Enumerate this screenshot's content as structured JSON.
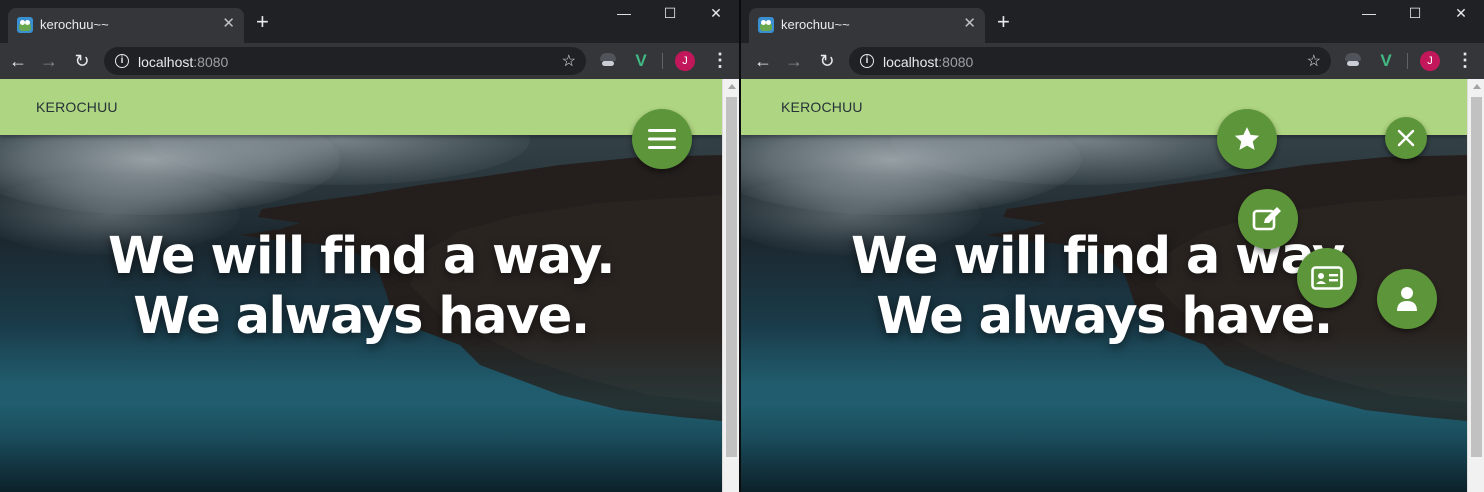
{
  "left": {
    "tab": {
      "title": "kerochuu~~",
      "close": "✕"
    },
    "new_tab": "+",
    "window_controls": {
      "minimize": "—",
      "maximize": "☐",
      "close": "✕"
    },
    "address": {
      "host": "localhost",
      "port": ":8080"
    },
    "profile_initial": "J",
    "app": {
      "brand": "KEROCHUU",
      "hero_line1": "We will find a way.",
      "hero_line2": "We always have.",
      "fab": {
        "state": "closed",
        "icon": "menu-icon"
      }
    }
  },
  "right": {
    "tab": {
      "title": "kerochuu~~",
      "close": "✕"
    },
    "new_tab": "+",
    "window_controls": {
      "minimize": "—",
      "maximize": "☐",
      "close": "✕"
    },
    "address": {
      "host": "localhost",
      "port": ":8080"
    },
    "profile_initial": "J",
    "app": {
      "brand": "KEROCHUU",
      "hero_line1": "We will find a way.",
      "hero_line2": "We always have.",
      "fab": {
        "state": "open",
        "icon": "close-icon",
        "actions": [
          "star-icon",
          "edit-icon",
          "contact-card-icon",
          "user-icon"
        ]
      }
    }
  },
  "colors": {
    "appbar": "#aed581",
    "fab": "#5d963a",
    "browser_chrome": "#202124",
    "toolbar": "#35363a"
  }
}
